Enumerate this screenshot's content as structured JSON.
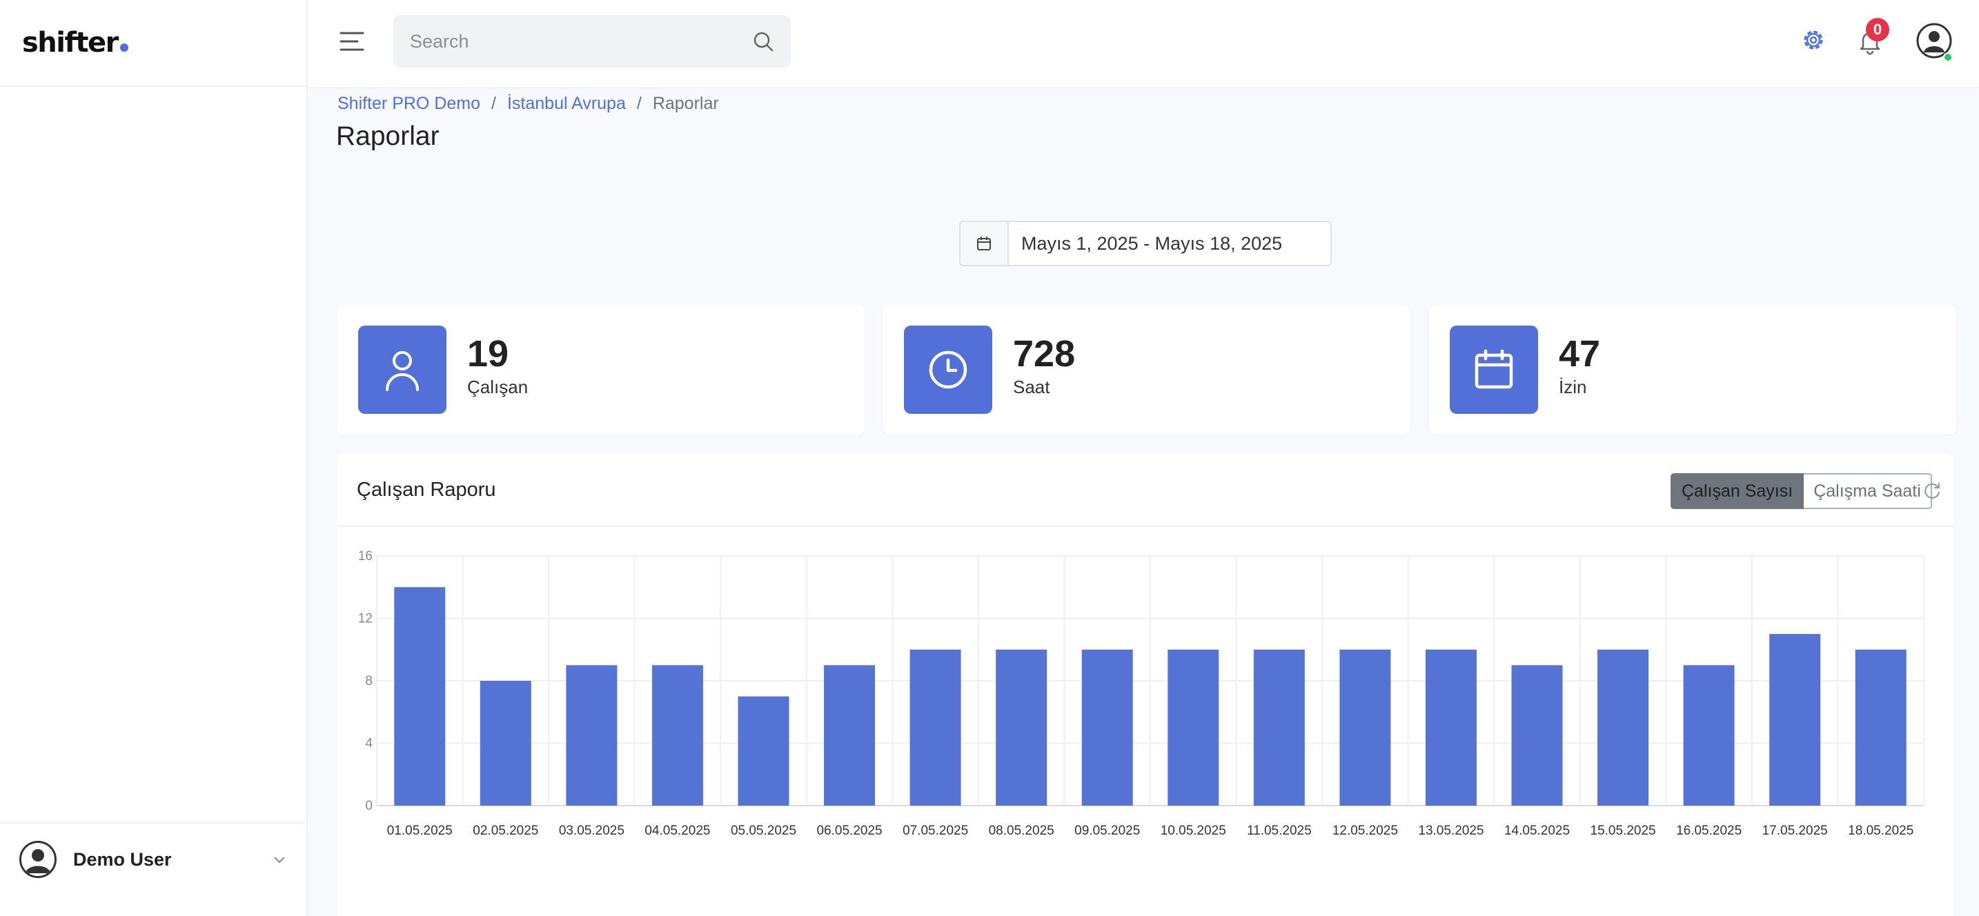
{
  "app": {
    "logo": "shifter"
  },
  "search": {
    "placeholder": "Search"
  },
  "notifications": {
    "count": "0"
  },
  "user": {
    "name": "Demo User"
  },
  "breadcrumb": {
    "items": [
      "Shifter PRO Demo",
      "İstanbul Avrupa",
      "Raporlar"
    ],
    "separator": "/"
  },
  "page": {
    "title": "Raporlar"
  },
  "date_range": "Mayıs 1, 2025 - Mayıs 18, 2025",
  "stats": [
    {
      "value": "19",
      "label": "Çalışan",
      "icon": "user-icon"
    },
    {
      "value": "728",
      "label": "Saat",
      "icon": "clock-icon"
    },
    {
      "value": "47",
      "label": "İzin",
      "icon": "calendar-icon"
    }
  ],
  "report": {
    "title": "Çalışan Raporu",
    "toggle_active": "Çalışan Sayısı",
    "toggle_other": "Çalışma Saati"
  },
  "colors": {
    "accent": "#5270d8",
    "bar": "#5573d5",
    "badge": "#e5334b",
    "online": "#28c76f"
  },
  "chart_data": {
    "type": "bar",
    "categories": [
      "01.05.2025",
      "02.05.2025",
      "03.05.2025",
      "04.05.2025",
      "05.05.2025",
      "06.05.2025",
      "07.05.2025",
      "08.05.2025",
      "09.05.2025",
      "10.05.2025",
      "11.05.2025",
      "12.05.2025",
      "13.05.2025",
      "14.05.2025",
      "15.05.2025",
      "16.05.2025",
      "17.05.2025",
      "18.05.2025"
    ],
    "values": [
      14,
      8,
      9,
      9,
      7,
      9,
      10,
      10,
      10,
      10,
      10,
      10,
      10,
      9,
      10,
      9,
      11,
      10
    ],
    "yticks": [
      0,
      4,
      8,
      12,
      16
    ],
    "ylim": [
      0,
      16
    ],
    "grid": true,
    "title": "",
    "xlabel": "",
    "ylabel": ""
  }
}
